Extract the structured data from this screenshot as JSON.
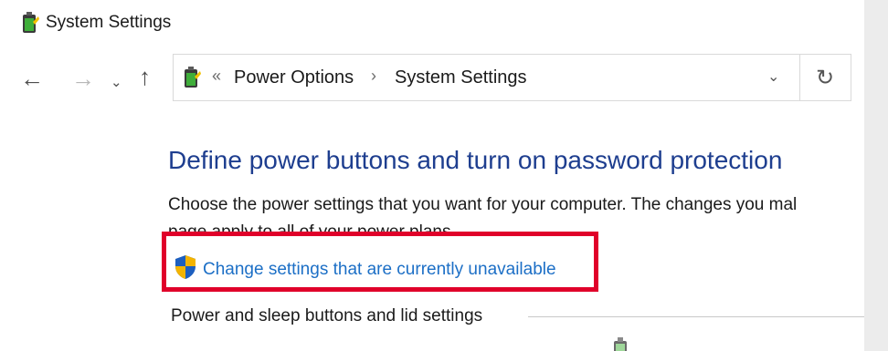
{
  "window": {
    "title": "System Settings"
  },
  "navigation": {
    "back_glyph": "←",
    "forward_glyph": "→",
    "recent_glyph": "⌄",
    "up_glyph": "↑"
  },
  "address_bar": {
    "overflow_glyph": "«",
    "crumbs": [
      "Power Options",
      "System Settings"
    ],
    "separator_glyph": "›",
    "dropdown_glyph": "⌄",
    "refresh_glyph": "↻"
  },
  "content": {
    "heading": "Define power buttons and turn on password protection",
    "description_line1": "Choose the power settings that you want for your computer. The changes you mal",
    "description_line2": "page apply to all of your power plans.",
    "change_link": "Change settings that are currently unavailable",
    "section_label": "Power and sleep buttons and lid settings"
  },
  "colors": {
    "heading": "#1e3e8f",
    "link": "#1c6fc6",
    "highlight_border": "#e0002a"
  },
  "icons": [
    "power-options-icon",
    "shield-icon"
  ]
}
